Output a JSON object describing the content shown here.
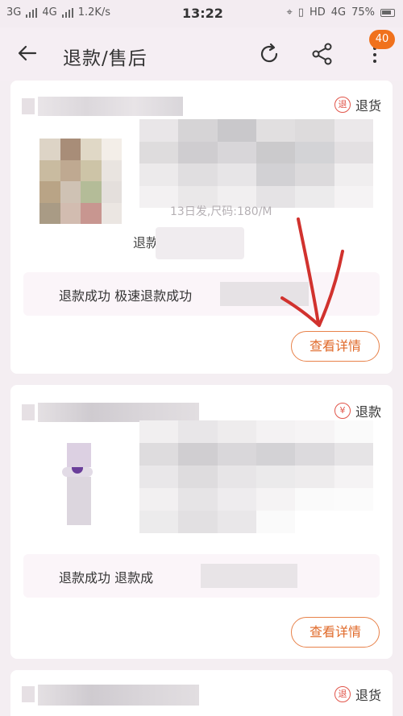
{
  "status_bar": {
    "network_left": "3G",
    "network_mid": "4G",
    "speed": "1.2K/s",
    "time": "13:22",
    "hd": "HD",
    "net_right": "4G",
    "battery": "75%"
  },
  "header": {
    "title": "退款/售后",
    "badge_count": "40"
  },
  "cards": [
    {
      "status_icon": "退",
      "status_label": "退货",
      "partial_text_1": "13日发,尺码:180/M",
      "partial_text_2": "退款",
      "refund_line": "退款成功   极速退款成功",
      "detail_label": "查看详情"
    },
    {
      "status_icon": "¥",
      "status_label": "退款",
      "refund_line": "退款成功   退款成",
      "detail_label": "查看详情"
    },
    {
      "status_icon": "退",
      "status_label": "退货"
    }
  ],
  "colors": {
    "accent": "#e06a2a",
    "badge": "#f0711c",
    "tag_red": "#e1554a",
    "annotation_arrow": "#d1322e"
  }
}
